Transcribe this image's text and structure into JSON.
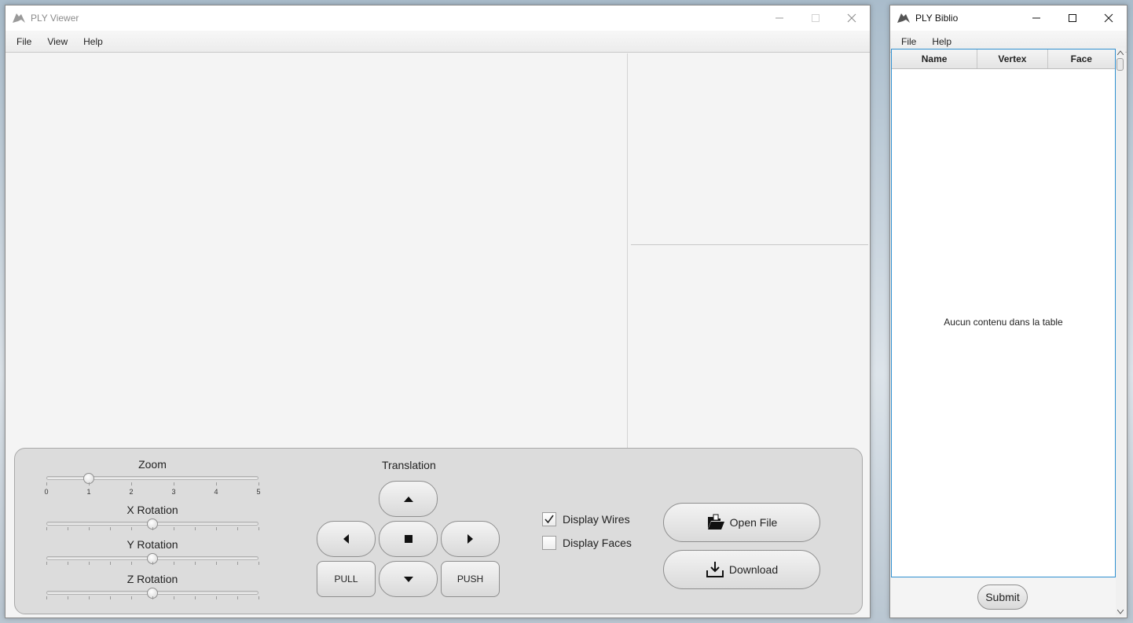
{
  "viewer": {
    "title": "PLY Viewer",
    "menu": [
      "File",
      "View",
      "Help"
    ],
    "controls": {
      "zoom": {
        "label": "Zoom",
        "value": 1,
        "min": 0,
        "max": 5,
        "ticks": [
          "0",
          "1",
          "2",
          "3",
          "4",
          "5"
        ]
      },
      "x_rotation": {
        "label": "X Rotation",
        "value": 0.5
      },
      "y_rotation": {
        "label": "Y Rotation",
        "value": 0.5
      },
      "z_rotation": {
        "label": "Z Rotation",
        "value": 0.5
      },
      "translation": {
        "label": "Translation",
        "pull_label": "PULL",
        "push_label": "PUSH"
      },
      "display_wires": {
        "label": "Display Wires",
        "checked": true
      },
      "display_faces": {
        "label": "Display Faces",
        "checked": false
      },
      "open_file_label": "Open File",
      "download_label": "Download"
    }
  },
  "biblio": {
    "title": "PLY Biblio",
    "menu": [
      "File",
      "Help"
    ],
    "table": {
      "columns": [
        "Name",
        "Vertex",
        "Face"
      ],
      "empty_message": "Aucun contenu dans la table"
    },
    "submit_label": "Submit"
  }
}
